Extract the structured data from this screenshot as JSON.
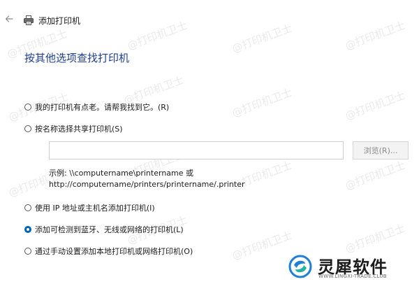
{
  "window": {
    "title": "添加打印机",
    "back_icon": "arrow-left-icon",
    "app_icon": "printer-icon"
  },
  "heading": "按其他选项查找打印机",
  "options": [
    {
      "label": "我的打印机有点老。请帮我找到它。(R)",
      "selected": false
    },
    {
      "label": "按名称选择共享打印机(S)",
      "selected": false
    },
    {
      "label": "使用 IP 地址或主机名添加打印机(I)",
      "selected": false
    },
    {
      "label": "添加可检测到蓝牙、无线或网络的打印机(L)",
      "selected": true
    },
    {
      "label": "通过手动设置添加本地打印机或网络打印机(O)",
      "selected": false
    }
  ],
  "share_name": {
    "value": "",
    "browse_label": "浏览(R)..."
  },
  "example": {
    "line1": "示例: \\\\computername\\printername 或",
    "line2": "http://computername/printers/printername/.printer"
  },
  "watermark_text": "@打印机卫士",
  "brand": {
    "name": "灵犀软件",
    "url": "WWW.LINGXI-TRADE.CLUB"
  },
  "colors": {
    "heading": "#1e3f8f",
    "accent": "#0063b1"
  }
}
